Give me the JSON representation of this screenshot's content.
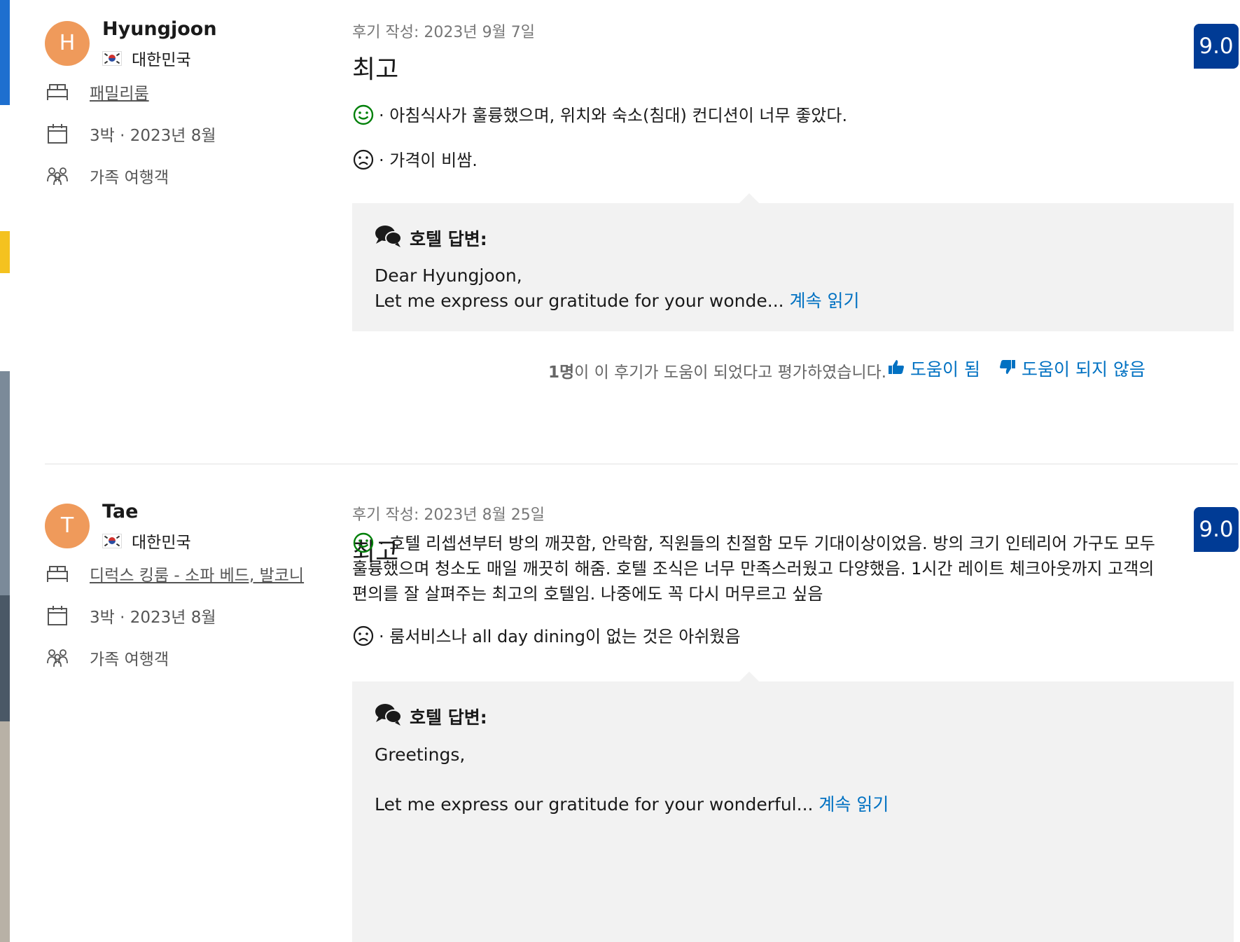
{
  "reviews": [
    {
      "avatar_letter": "H",
      "name": "Hyungjoon",
      "country": "대한민국",
      "room_type": "패밀리룸",
      "stay": "3박 · 2023년 8월",
      "traveler_type": "가족 여행객",
      "date": "후기 작성: 2023년 9월 7일",
      "title": "최고",
      "score": "9.0",
      "positive": "· 아침식사가 훌륭했으며, 위치와 숙소(침대) 컨디션이 너무 좋았다.",
      "negative": "· 가격이 비쌈.",
      "reply_heading": "호텔 답변:",
      "reply_line1": "Dear Hyungjoon,",
      "reply_line2": "Let me express our gratitude for your wonde...",
      "read_more": "계속 읽기",
      "helpful_count": "1명",
      "helpful_text": "이 이 후기가 도움이 되었다고 평가하였습니다.",
      "helpful_button": "도움이 됨",
      "not_helpful_button": "도움이 되지 않음"
    },
    {
      "avatar_letter": "T",
      "name": "Tae",
      "country": "대한민국",
      "room_type": "디럭스 킹룸 - 소파 베드, 발코니",
      "stay": "3박 · 2023년 8월",
      "traveler_type": "가족 여행객",
      "date": "후기 작성: 2023년 8월 25일",
      "title": "최고",
      "score": "9.0",
      "positive_line1": "· 호텔 리셉션부터 방의 깨끗함, 안락함, 직원들의 친절함 모두 기대이상이었음. 방의 크기 인테리어 가구도 모두",
      "positive_line2": "훌륭했으며 청소도 매일 깨끗히 해줌. 호텔 조식은 너무 만족스러웠고 다양했음. 1시간 레이트 체크아웃까지 고객의",
      "positive_line3": "편의를 잘 살펴주는 최고의 호텔임. 나중에도 꼭 다시 머무르고 싶음",
      "negative": "· 룸서비스나 all day dining이 없는 것은 아쉬웠음",
      "reply_heading": "호텔 답변:",
      "reply_line1": "Greetings,",
      "reply_line2": "Let me express our gratitude for your wonderful...",
      "read_more": "계속 읽기"
    }
  ],
  "icons": {
    "bed": "bed-icon",
    "calendar": "calendar-icon",
    "group": "group-icon",
    "smile": "smile-icon",
    "frown": "frown-icon",
    "chat": "chat-bubbles-icon",
    "thumbs_up": "thumbs-up-icon",
    "thumbs_down": "thumbs-down-icon"
  },
  "colors": {
    "score_bg": "#003b95",
    "link": "#0071c2",
    "positive": "#008009",
    "avatar": "#ef9a5b",
    "reply_bg": "#f2f2f2"
  }
}
